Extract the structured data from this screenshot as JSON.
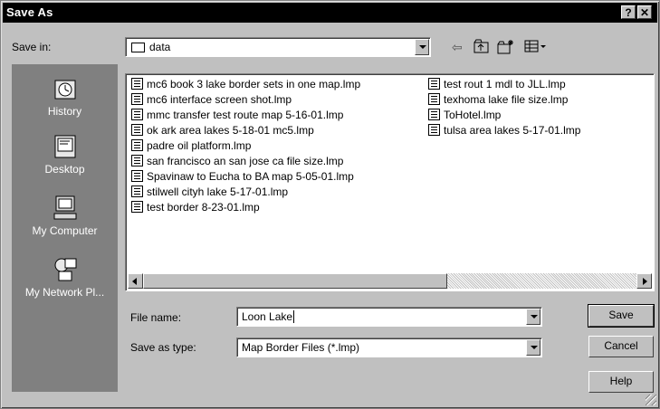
{
  "window": {
    "title": "Save As",
    "help_btn": "?",
    "close_btn": "✕"
  },
  "toolbar": {
    "save_in_label": "Save in:",
    "save_in_accel": "i",
    "current_folder": "data",
    "icons": [
      "back-icon",
      "up-folder-icon",
      "new-folder-icon",
      "view-menu-icon"
    ]
  },
  "places": [
    {
      "label": "History",
      "icon": "history-icon"
    },
    {
      "label": "Desktop",
      "icon": "desktop-icon"
    },
    {
      "label": "My Computer",
      "icon": "my-computer-icon"
    },
    {
      "label": "My Network Pl...",
      "icon": "network-icon"
    }
  ],
  "files": {
    "column1": [
      "mc6 book 3 lake border sets in one map.lmp",
      "mc6 interface screen shot.lmp",
      "mmc transfer test route map 5-16-01.lmp",
      "ok ark area lakes 5-18-01 mc5.lmp",
      "padre oil platform.lmp",
      "san francisco an san jose ca file size.lmp",
      "Spavinaw to Eucha to BA map 5-05-01.lmp",
      "stilwell cityh lake 5-17-01.lmp",
      "test border 8-23-01.lmp"
    ],
    "column2": [
      "test rout 1 mdl to JLL.lmp",
      "texhoma lake file size.lmp",
      "ToHotel.lmp",
      "tulsa area lakes 5-17-01.lmp"
    ]
  },
  "form": {
    "file_name_label": "File name:",
    "file_name_value": "Loon Lake",
    "save_type_label": "Save as type:",
    "save_type_value": "Map Border Files (*.lmp)"
  },
  "buttons": {
    "save": "Save",
    "cancel": "Cancel",
    "help": "Help"
  }
}
